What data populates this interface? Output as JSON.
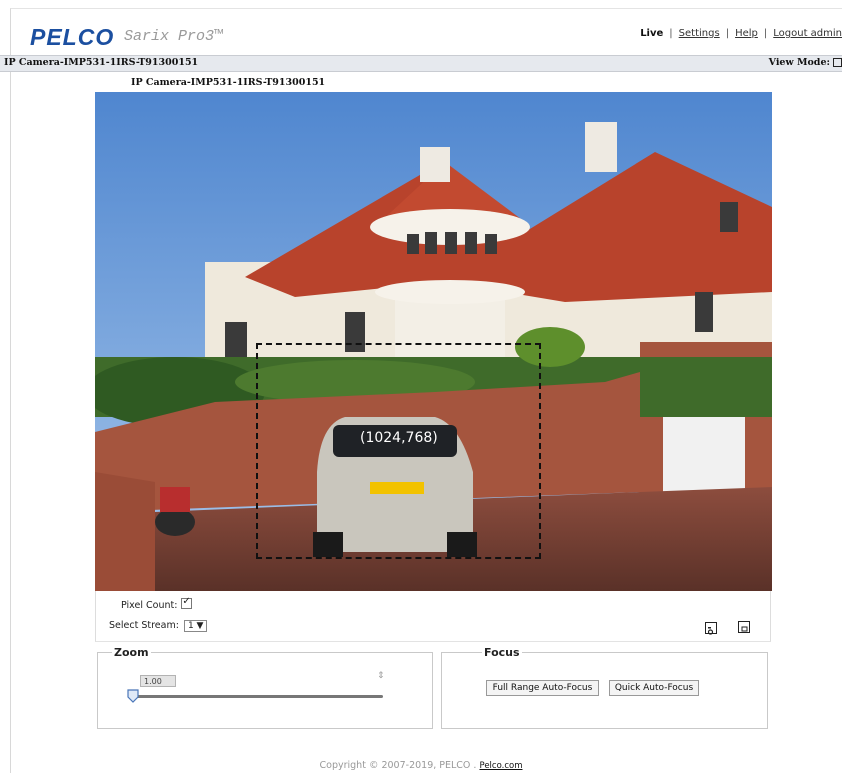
{
  "header": {
    "logo": "PELCO",
    "product": "Sarix Pro3™",
    "nav": [
      {
        "label": "Live",
        "active": true
      },
      {
        "label": "Settings",
        "active": false
      },
      {
        "label": "Help",
        "active": false
      },
      {
        "label": "Logout admin",
        "active": false
      }
    ],
    "separator": "|"
  },
  "camera_bar": {
    "title": "IP Camera-IMP531-1IRS-T91300151",
    "view_mode_label": "View Mode:"
  },
  "video": {
    "subtitle": "IP Camera-IMP531-1IRS-T91300151",
    "pixel_count_label": "(1024,768)"
  },
  "controls": {
    "pixel_count_label": "Pixel Count:",
    "pixel_count_checked": true,
    "select_stream_label": "Select Stream:",
    "stream_value": "1",
    "stream_arrow": "▼"
  },
  "zoom": {
    "legend": "Zoom",
    "value": "1.00",
    "spin_glyph": "⇕",
    "level": 0.0
  },
  "focus": {
    "legend": "Focus",
    "full_range_button": "Full Range Auto-Focus",
    "quick_button": "Quick Auto-Focus"
  },
  "footer": {
    "copyright": "Copyright © 2007-2019, PELCO .",
    "link": "Pelco.com"
  },
  "colors": {
    "brand_blue": "#1b4fa0",
    "sky": "#6a9ad6",
    "roof": "#b8432c",
    "brick": "#a5553e"
  }
}
